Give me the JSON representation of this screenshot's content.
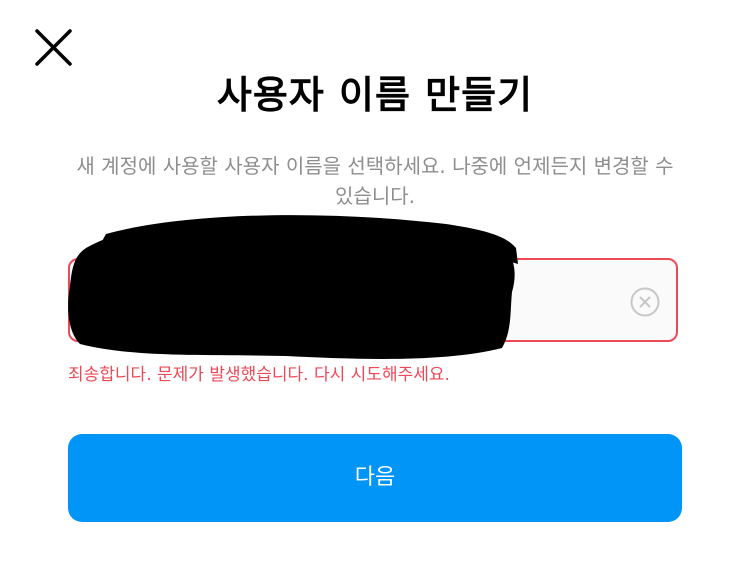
{
  "header": {
    "close_icon": "close-icon",
    "title": "사용자 이름 만들기",
    "subtitle": "새 계정에 사용할 사용자 이름을 선택하세요. 나중에 언제든지 변경할 수 있습니다."
  },
  "username_field": {
    "value": "",
    "placeholder": "",
    "clear_icon": "clear-circle-x-icon",
    "redacted": true
  },
  "error": {
    "message": "죄송합니다. 문제가 발생했습니다. 다시 시도해주세요."
  },
  "actions": {
    "next_label": "다음"
  },
  "colors": {
    "primary": "#0095f6",
    "error": "#ed4956",
    "title_text": "#000000",
    "subtitle_text": "#8e8e8e",
    "input_background": "#fafafa"
  }
}
